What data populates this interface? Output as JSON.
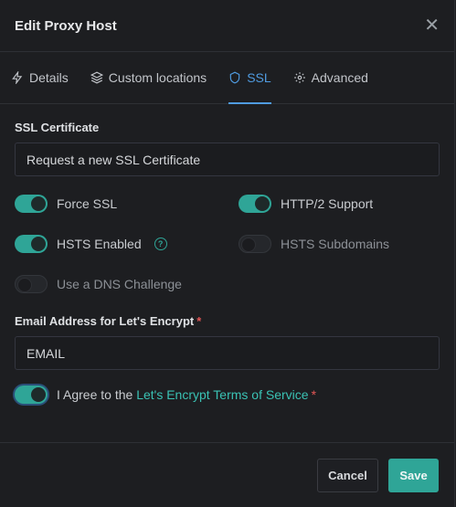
{
  "header": {
    "title": "Edit Proxy Host",
    "close_label": "✕"
  },
  "tabs": [
    {
      "label": "Details",
      "icon": "bolt-icon",
      "active": false
    },
    {
      "label": "Custom locations",
      "icon": "layers-icon",
      "active": false
    },
    {
      "label": "SSL",
      "icon": "shield-icon",
      "active": true
    },
    {
      "label": "Advanced",
      "icon": "gear-icon",
      "active": false
    }
  ],
  "ssl": {
    "label": "SSL Certificate",
    "value": "Request a new SSL Certificate"
  },
  "toggles": {
    "force_ssl": {
      "label": "Force SSL",
      "on": true
    },
    "http2": {
      "label": "HTTP/2 Support",
      "on": true
    },
    "hsts": {
      "label": "HSTS Enabled",
      "on": true,
      "help": "?"
    },
    "hsts_sub": {
      "label": "HSTS Subdomains",
      "on": false
    },
    "dns": {
      "label": "Use a DNS Challenge",
      "on": false
    }
  },
  "email": {
    "label": "Email Address for Let's Encrypt",
    "required_mark": "*",
    "value": "EMAIL"
  },
  "agree": {
    "prefix": "I Agree to the",
    "link": "Let's Encrypt Terms of Service",
    "required_mark": "*",
    "on": true
  },
  "footer": {
    "cancel_label": "Cancel",
    "save_label": "Save"
  },
  "colors": {
    "accent": "#2fa597",
    "tab_active": "#4f9be0",
    "link": "#3ac2b4",
    "required": "#e35656",
    "background": "#1d1e21"
  }
}
